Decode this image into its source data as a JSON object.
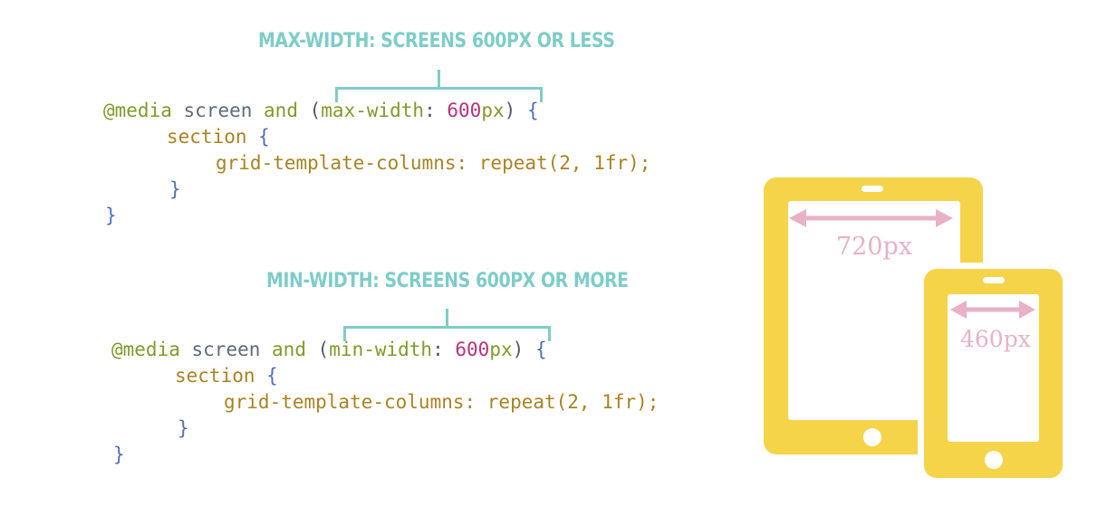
{
  "colors": {
    "heading": "#7ecdc9",
    "device_body": "#f5d449",
    "arrow": "#e8b1c6",
    "label": "#e8b1c6"
  },
  "max_block": {
    "heading": "MAX-WIDTH: SCREENS 600PX OR LESS",
    "media_keyword": "@media",
    "screen": "screen",
    "and": "and",
    "open_paren": "(",
    "feature": "max-width",
    "colon": ":",
    "value_num": "600",
    "value_unit": "px",
    "close_paren": ")",
    "open_brace": "{",
    "selector": "section",
    "selector_brace": "{",
    "declaration": "grid-template-columns: repeat(2, 1fr);",
    "inner_close": "}",
    "outer_close": "}"
  },
  "min_block": {
    "heading": "MIN-WIDTH: SCREENS 600PX OR MORE",
    "media_keyword": "@media",
    "screen": "screen",
    "and": "and",
    "open_paren": "(",
    "feature": "min-width",
    "colon": ":",
    "value_num": "600",
    "value_unit": "px",
    "close_paren": ")",
    "open_brace": "{",
    "selector": "section",
    "selector_brace": "{",
    "declaration": "grid-template-columns: repeat(2, 1fr);",
    "inner_close": "}",
    "outer_close": "}"
  },
  "devices": {
    "tablet": {
      "icon": "tablet-icon",
      "width_label": "720px"
    },
    "phone": {
      "icon": "phone-icon",
      "width_label": "460px"
    }
  }
}
